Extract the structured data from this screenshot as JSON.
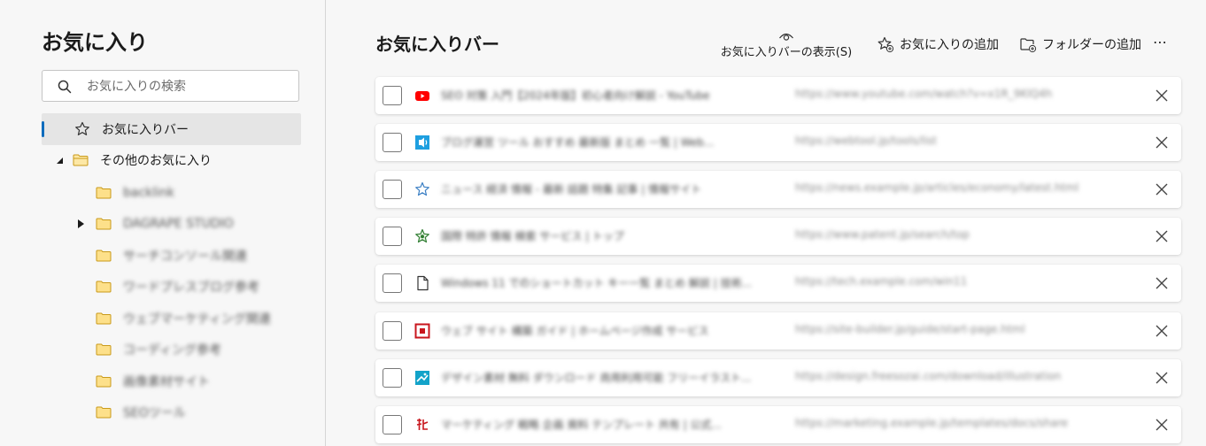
{
  "sidebar": {
    "title": "お気に入り",
    "search_placeholder": "お気に入りの検索",
    "items": [
      {
        "label": "お気に入りバー"
      },
      {
        "label": "その他のお気に入り"
      },
      {
        "label": "backlink"
      },
      {
        "label": "DAGRAPE STUDIO"
      },
      {
        "label": "サーチコンソール関連"
      },
      {
        "label": "ワードプレスブログ参考"
      },
      {
        "label": "ウェブマーケティング関連"
      },
      {
        "label": "コーディング参考"
      },
      {
        "label": "画像素材サイト"
      },
      {
        "label": "SEOツール"
      }
    ]
  },
  "main": {
    "title": "お気に入りバー",
    "toolbar": {
      "show_bar_label": "お気に入りバーの表示(S)",
      "add_favorite_label": "お気に入りの追加",
      "add_folder_label": "フォルダーの追加",
      "more_label": "⋯"
    },
    "rows": [
      {
        "icon": "youtube-icon",
        "title": "SEO 対策 入門【2024年版】初心者向け解説 - YouTube",
        "url": "https://www.youtube.com/watch?v=x1R_9KlQ4h"
      },
      {
        "icon": "sound-icon",
        "title": "ブログ運営 ツール おすすめ 最新版 まとめ 一覧 | Web...",
        "url": "https://webtool.jp/tools/list"
      },
      {
        "icon": "star-outline-icon",
        "title": "ニュース 経済 情報 - 最新 話題 特集 記事 | 情報サイト",
        "url": "https://news.example.jp/articles/economy/latest.html"
      },
      {
        "icon": "star-green-icon",
        "title": "国際 特許 情報 検索 サービス | トップ",
        "url": "https://www.patent.jp/search/top"
      },
      {
        "icon": "document-icon",
        "title": "Windows 11 でのショートカット キー一覧 まとめ 解説 | 技術...",
        "url": "https://tech.example.com/win11"
      },
      {
        "icon": "red-square-icon",
        "title": "ウェブ サイト 構築 ガイド | ホームページ作成 サービス",
        "url": "https://site-builder.jp/guide/start-page.html"
      },
      {
        "icon": "image-icon",
        "title": "デザイン素材 無料 ダウンロード 商用利用可能 フリーイラスト...",
        "url": "https://design.freesozai.com/download/illustration"
      },
      {
        "icon": "red-logo-icon",
        "title": "マーケティング 戦略 企画 資料 テンプレート 共有 | 公式...",
        "url": "https://marketing.example.jp/templates/docs/share"
      }
    ]
  }
}
